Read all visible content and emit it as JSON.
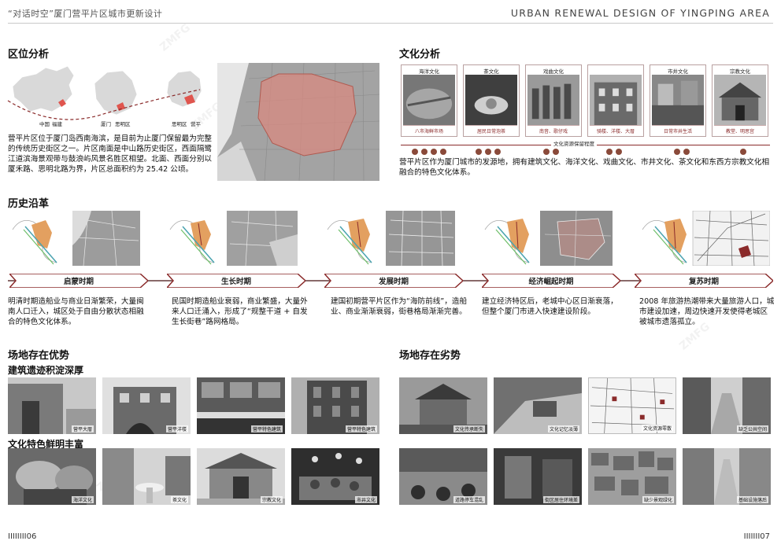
{
  "header": {
    "left_title": "“对话时空”厦门营平片区城市更新设计",
    "right_title": "URBAN RENEWAL DESIGN OF YINGPING AREA"
  },
  "location": {
    "title": "区位分析",
    "map_labels": [
      "中国",
      "福建",
      "厦门",
      "思明区",
      "思明区",
      "营平"
    ],
    "text": "营平片区位于厦门岛西南海滨，是目前为止厦门保留最为完整的传统历史街区之一。片区南面是中山路历史街区，西面隔鹭江道滨海景观带与鼓浪屿风景名胜区相望。北面、西面分别以厦禾路、思明北路为界，片区总面积约为 25.42 公顷。"
  },
  "culture": {
    "title": "文化分析",
    "items": [
      {
        "top": "海洋文化",
        "bottom": "八市海鲜市场"
      },
      {
        "top": "茶文化",
        "bottom": "居民日常泡茶"
      },
      {
        "top": "戏曲文化",
        "bottom": "南音、歌仔戏"
      },
      {
        "top": "",
        "bottom": "骑楼、洋楼、大厝"
      },
      {
        "top": "市井文化",
        "bottom": "日常市井生活"
      },
      {
        "top": "宗教文化",
        "bottom": "教堂、明思宫"
      }
    ],
    "axis_label": "文化资源保留程度",
    "text": "营平片区作为厦门城市的发源地，拥有建筑文化、海洋文化、戏曲文化、市井文化、茶文化和东西方宗教文化相融合的特色文化体系。"
  },
  "history": {
    "title": "历史沿革",
    "periods": [
      {
        "label": "启蒙时期",
        "text": "明清时期造船业与商业日渐繁荣，大量闽南人口迁入，城区处于自由分散状态相融合的特色文化体系。"
      },
      {
        "label": "生长时期",
        "text": "民国时期造船业衰弱，商业繁盛，大量外来人口迁涌入，形成了“规整干道 + 自发生长街巷”路网格局。"
      },
      {
        "label": "发展时期",
        "text": "建国初期营平片区作为“海防前线”，造船业、商业渐渐衰弱，街巷格局渐渐完善。"
      },
      {
        "label": "经济崛起时期",
        "text": "建立经济特区后，老城中心区日渐衰落，但整个厦门市进入快速建设阶段。"
      },
      {
        "label": "复苏时期",
        "text": "2008 年旅游热潮带来大量旅游人口，城市建设加速，周边快速开发使得老城区被城市遗落孤立。"
      }
    ]
  },
  "advantages": {
    "title": "场地存在优势",
    "sub1": "建筑遗迹积淀深厚",
    "sub2": "文化特色鲜明丰富",
    "row1": [
      "营平大厝",
      "营平洋楼",
      "营平特色建筑",
      "营平特色建筑"
    ],
    "row2": [
      "海洋文化",
      "茶文化",
      "宗教文化",
      "市井文化"
    ]
  },
  "disadvantages": {
    "title": "场地存在劣势",
    "row1": [
      "文化传承断失",
      "文化记忆淡薄",
      "文化资源零散",
      "缺乏公共空间"
    ],
    "row2": [
      "道路停车混乱",
      "街区居住环境差",
      "缺少景观绿化",
      "基础设施落后"
    ]
  },
  "footer": {
    "left_page": "IIIIIIII06",
    "right_page": "IIIIIII07"
  },
  "colors": {
    "accent": "#8a2a2a",
    "site_fill": "#d88a80"
  }
}
